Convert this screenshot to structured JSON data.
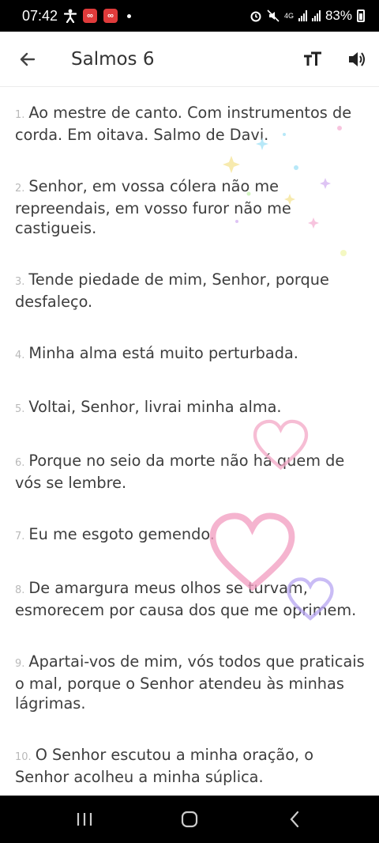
{
  "status": {
    "time": "07:42",
    "battery": "83%",
    "network": "4G"
  },
  "header": {
    "title": "Salmos 6",
    "back_icon": "arrow-left-icon",
    "text_size_icon": "text-size-icon",
    "audio_icon": "volume-icon"
  },
  "verses": [
    {
      "num": "1.",
      "text": "Ao mestre de canto. Com instrumentos de corda. Em oitava. Salmo de Davi."
    },
    {
      "num": "2.",
      "text": "Senhor, em vossa cólera não me repreendais, em vosso furor não me castigueis."
    },
    {
      "num": "3.",
      "text": "Tende piedade de mim, Senhor, porque desfaleço."
    },
    {
      "num": "4.",
      "text": "Minha alma está muito perturbada."
    },
    {
      "num": "5.",
      "text": "Voltai, Senhor, livrai minha alma."
    },
    {
      "num": "6.",
      "text": "Porque no seio da morte não há quem de vós se lembre."
    },
    {
      "num": "7.",
      "text": "Eu me esgoto gemendo."
    },
    {
      "num": "8.",
      "text": "De amargura meus olhos se turvam, esmorecem por causa dos que me oprimem."
    },
    {
      "num": "9.",
      "text": "Apartai-vos de mim, vós todos que praticais o mal, porque o Senhor atendeu às minhas lágrimas."
    },
    {
      "num": "10.",
      "text": "O Senhor escutou a minha oração, o Senhor acolheu a minha súplica."
    }
  ],
  "nav": {
    "recents_icon": "recent-apps-icon",
    "home_icon": "home-icon",
    "back_icon": "back-chevron-icon"
  }
}
